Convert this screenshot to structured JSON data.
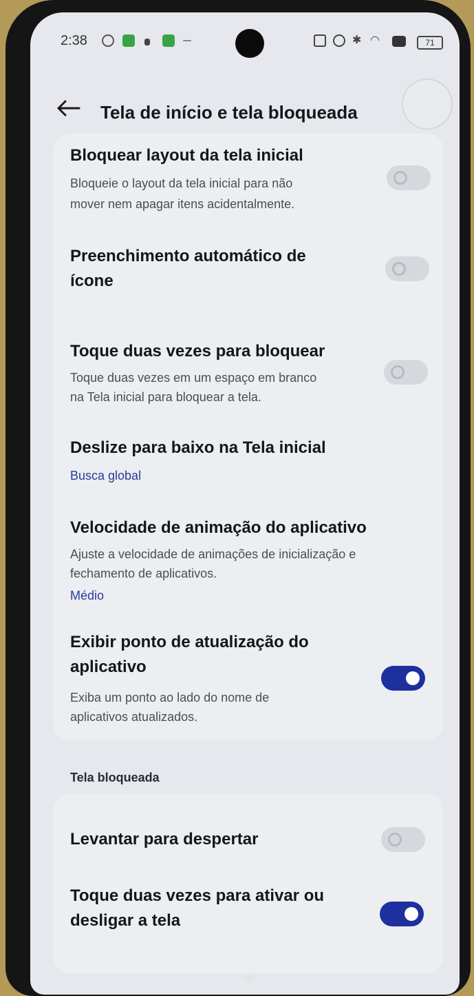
{
  "status_bar": {
    "time": "2:38",
    "battery": "71"
  },
  "header": {
    "title": "Tela de início e tela bloqueada",
    "back_icon": "arrow-left-icon"
  },
  "settings": {
    "lock_layout": {
      "title": "Bloquear layout da tela inicial",
      "desc_1": "Bloqueie o layout da tela inicial para não",
      "desc_2": "mover nem apagar itens acidentalmente.",
      "enabled": false
    },
    "auto_fill_icon": {
      "title_1": "Preenchimento automático de",
      "title_2": "ícone",
      "enabled": false
    },
    "double_tap_lock": {
      "title": "Toque duas vezes para bloquear",
      "desc_1": "Toque duas vezes em um espaço em branco",
      "desc_2": "na Tela inicial para bloquear a tela.",
      "enabled": false
    },
    "swipe_down": {
      "title": "Deslize para baixo na Tela inicial",
      "value": "Busca global"
    },
    "animation_speed": {
      "title": "Velocidade de animação do aplicativo",
      "desc_1": "Ajuste a velocidade de animações de inicialização e",
      "desc_2": "fechamento de aplicativos.",
      "value": "Médio"
    },
    "update_dot": {
      "title_1": "Exibir ponto de atualização do",
      "title_2": "aplicativo",
      "desc_1": "Exiba um ponto ao lado do nome de",
      "desc_2": "aplicativos atualizados.",
      "enabled": true
    }
  },
  "lock_screen": {
    "section_label": "Tela bloqueada",
    "raise_to_wake": {
      "title": "Levantar para despertar",
      "enabled": false
    },
    "double_tap_screen": {
      "title_1": "Toque duas vezes para ativar ou",
      "title_2": "desligar a tela",
      "enabled": true
    }
  },
  "colors": {
    "accent": "#1e2f9e",
    "link": "#2b3a9a"
  }
}
